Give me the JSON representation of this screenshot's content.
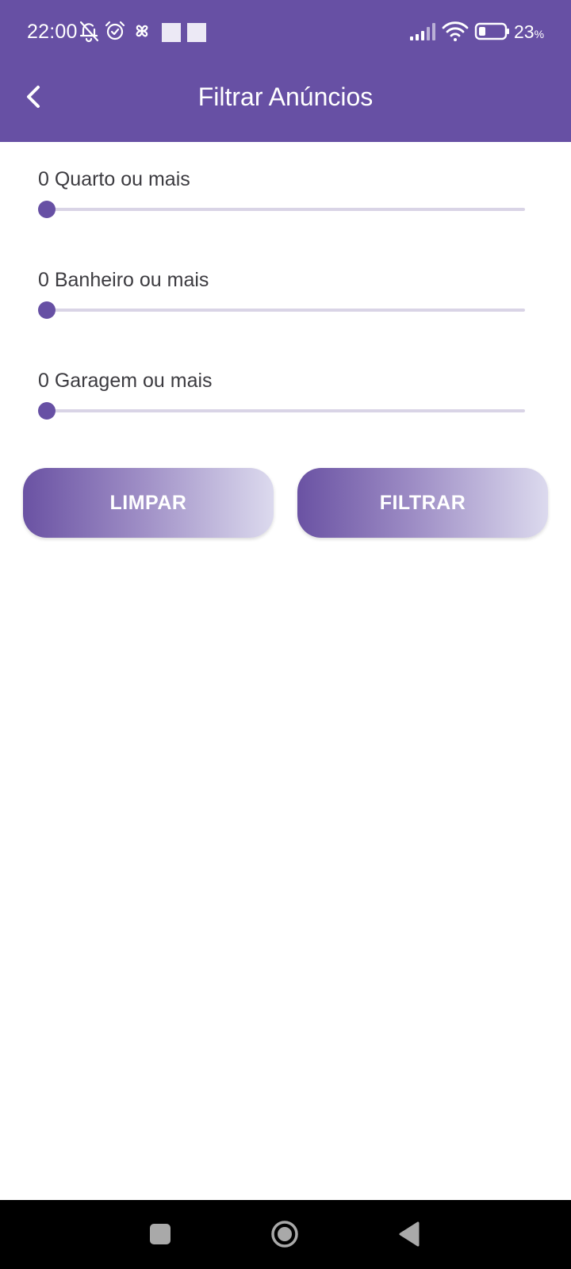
{
  "status_bar": {
    "time": "22:00",
    "battery_percent": "23",
    "battery_unit": "%",
    "icons": [
      "notifications-off-icon",
      "alarm-icon",
      "pinwheel-icon",
      "notification-square-icon",
      "notification-square-icon",
      "signal-icon",
      "wifi-icon",
      "battery-icon"
    ]
  },
  "app_bar": {
    "title": "Filtrar Anúncios",
    "back_icon": "chevron-left-icon"
  },
  "filters": [
    {
      "label": "0 Quarto ou mais",
      "value": 0
    },
    {
      "label": "0 Banheiro ou mais",
      "value": 0
    },
    {
      "label": "0 Garagem ou mais",
      "value": 0
    }
  ],
  "buttons": {
    "clear": "LIMPAR",
    "filter": "FILTRAR"
  },
  "nav_bar": {
    "icons": [
      "recents-square-icon",
      "home-circle-icon",
      "back-triangle-icon"
    ]
  },
  "colors": {
    "primary": "#6750a4",
    "track": "#d9d4e6",
    "button_gradient_start": "#6a52a3",
    "button_gradient_end": "#dcdaee",
    "text": "#3c3b40"
  }
}
